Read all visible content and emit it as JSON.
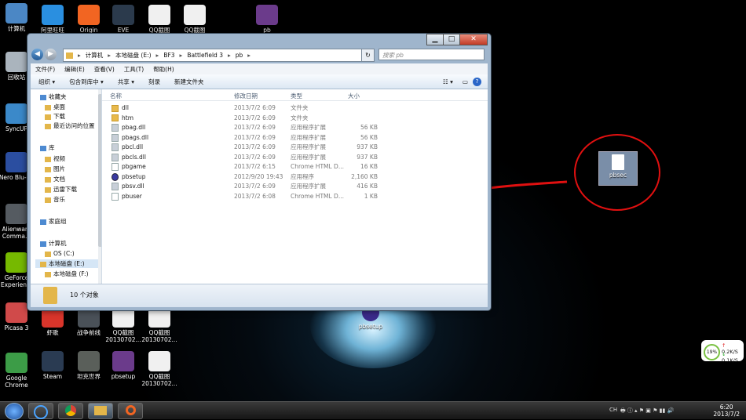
{
  "desktop": {
    "icons_left": [
      {
        "label": "计算机",
        "color": "#4b87c5"
      },
      {
        "label": "回收站",
        "color": "#aab4bd"
      },
      {
        "label": "SyncUP",
        "color": "#3b89c9"
      },
      {
        "label": "Nero Blu-r...",
        "color": "#2b4ea0"
      },
      {
        "label": "Alienware Comma...",
        "color": "#555b61"
      },
      {
        "label": "GeForce Experien...",
        "color": "#76b900"
      },
      {
        "label": "Picasa 3",
        "color": "#d04a4a"
      },
      {
        "label": "Google Chrome",
        "color": "#3c9c47"
      }
    ],
    "icons_top": [
      {
        "label": "阿里旺旺",
        "color": "#2a8fe0"
      },
      {
        "label": "Origin",
        "color": "#f26522"
      },
      {
        "label": "EVE",
        "color": "#2b3a4c"
      },
      {
        "label": "QQ截图",
        "color": "#f0f0f0"
      },
      {
        "label": "QQ截图",
        "color": "#f0f0f0"
      },
      {
        "label": "pb",
        "color": "#6b3b8b"
      }
    ],
    "icons_bottom": [
      {
        "label": "虾歌",
        "color": "#d9352b"
      },
      {
        "label": "战争前线",
        "color": "#4a5158"
      },
      {
        "label": "QQ截图 20130702...",
        "color": "#f0f0f0"
      },
      {
        "label": "QQ截图 20130702...",
        "color": "#f0f0f0"
      },
      {
        "label": "Steam",
        "color": "#2a3b52"
      },
      {
        "label": "坦克世界",
        "color": "#5a5f5a"
      },
      {
        "label": "pbsetup",
        "color": "#6b3b8b"
      },
      {
        "label": "QQ截图 20130702...",
        "color": "#f0f0f0"
      }
    ],
    "center_icon_label": "pbsetup",
    "highlight_icon_label": "pbsec",
    "annotation_color": "#e01010"
  },
  "window": {
    "breadcrumb": [
      "计算机",
      "本地磁盘 (E:)",
      "BF3",
      "Battlefield 3",
      "pb"
    ],
    "search_placeholder": "搜索 pb",
    "menu": [
      "文件(F)",
      "编辑(E)",
      "查看(V)",
      "工具(T)",
      "帮助(H)"
    ],
    "toolbar": [
      "组织 ▾",
      "包含到库中 ▾",
      "共享 ▾",
      "刻录",
      "新建文件夹"
    ],
    "nav": [
      {
        "label": "收藏夹",
        "level": 0
      },
      {
        "label": "桌面",
        "level": 1
      },
      {
        "label": "下载",
        "level": 1
      },
      {
        "label": "最近访问的位置",
        "level": 1
      },
      {
        "label": "库",
        "level": 0
      },
      {
        "label": "视频",
        "level": 1
      },
      {
        "label": "图片",
        "level": 1
      },
      {
        "label": "文档",
        "level": 1
      },
      {
        "label": "迅雷下载",
        "level": 1
      },
      {
        "label": "音乐",
        "level": 1
      },
      {
        "label": "家庭组",
        "level": 0
      },
      {
        "label": "计算机",
        "level": 0
      },
      {
        "label": "OS (C:)",
        "level": 1
      },
      {
        "label": "本地磁盘 (E:)",
        "level": 1
      },
      {
        "label": "本地磁盘 (F:)",
        "level": 1
      }
    ],
    "columns": [
      "名称",
      "修改日期",
      "类型",
      "大小"
    ],
    "files": [
      {
        "name": "dll",
        "date": "2013/7/2 6:09",
        "type": "文件夹",
        "size": "",
        "icon": "folder"
      },
      {
        "name": "htm",
        "date": "2013/7/2 6:09",
        "type": "文件夹",
        "size": "",
        "icon": "folder"
      },
      {
        "name": "pbag.dll",
        "date": "2013/7/2 6:09",
        "type": "应用程序扩展",
        "size": "56 KB",
        "icon": "gear"
      },
      {
        "name": "pbags.dll",
        "date": "2013/7/2 6:09",
        "type": "应用程序扩展",
        "size": "56 KB",
        "icon": "gear"
      },
      {
        "name": "pbcl.dll",
        "date": "2013/7/2 6:09",
        "type": "应用程序扩展",
        "size": "937 KB",
        "icon": "gear"
      },
      {
        "name": "pbcls.dll",
        "date": "2013/7/2 6:09",
        "type": "应用程序扩展",
        "size": "937 KB",
        "icon": "gear"
      },
      {
        "name": "pbgame",
        "date": "2013/7/2 6:15",
        "type": "Chrome HTML D...",
        "size": "16 KB",
        "icon": "file"
      },
      {
        "name": "pbsetup",
        "date": "2012/9/20 19:43",
        "type": "应用程序",
        "size": "2,160 KB",
        "icon": "pb"
      },
      {
        "name": "pbsv.dll",
        "date": "2013/7/2 6:09",
        "type": "应用程序扩展",
        "size": "416 KB",
        "icon": "gear"
      },
      {
        "name": "pbuser",
        "date": "2013/7/2 6:08",
        "type": "Chrome HTML D...",
        "size": "1 KB",
        "icon": "file"
      }
    ],
    "status_text": "10 个对象"
  },
  "network_widget": {
    "percent": "19%",
    "up": "0.2K/S",
    "down": "0.1K/S"
  },
  "taskbar": {
    "time": "6:20",
    "date": "2013/7/2",
    "lang": "CH"
  }
}
